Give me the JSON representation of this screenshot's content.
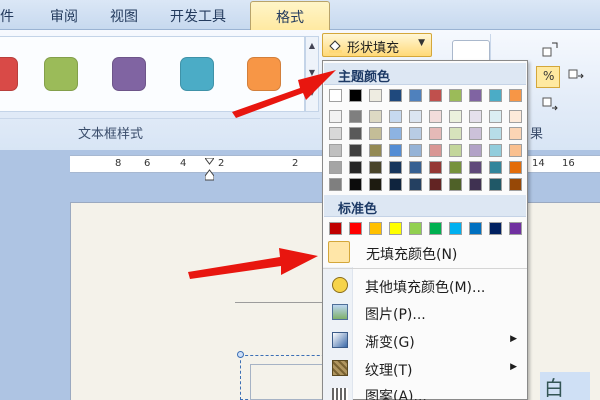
{
  "tabs": [
    {
      "label": "邮件"
    },
    {
      "label": "审阅"
    },
    {
      "label": "视图"
    },
    {
      "label": "开发工具"
    },
    {
      "label": "格式",
      "active": true
    }
  ],
  "gallery": {
    "swatch_colors": [
      "#d94a47",
      "#9bbb59",
      "#8064a2",
      "#4bacc6",
      "#f79646"
    ],
    "group_label": "文本框样式"
  },
  "fill_button": {
    "label": "形状填充"
  },
  "right_group_label": "果",
  "ruler_numbers": [
    "8",
    "6",
    "4",
    "2",
    "2",
    "14",
    "16"
  ],
  "menu": {
    "theme_header": "主题颜色",
    "theme_top_row": [
      "#ffffff",
      "#000000",
      "#eeece1",
      "#1f497d",
      "#4f81bd",
      "#c0504d",
      "#9bbb59",
      "#8064a2",
      "#4bacc6",
      "#f79646"
    ],
    "theme_shades": [
      [
        "#f2f2f2",
        "#7f7f7f",
        "#ddd9c3",
        "#c6d9f0",
        "#dbe5f1",
        "#f2dcdb",
        "#ebf1dd",
        "#e5e0ec",
        "#dbeef3",
        "#fdeada"
      ],
      [
        "#d8d8d8",
        "#595959",
        "#c4bd97",
        "#8db3e2",
        "#b8cce4",
        "#e5b9b7",
        "#d7e3bc",
        "#ccc1d9",
        "#b7dde8",
        "#fbd5b5"
      ],
      [
        "#bfbfbf",
        "#3f3f3f",
        "#938953",
        "#548dd4",
        "#95b3d7",
        "#d99694",
        "#c3d69b",
        "#b2a2c7",
        "#92cddc",
        "#fac08f"
      ],
      [
        "#a5a5a5",
        "#262626",
        "#494429",
        "#17365d",
        "#366092",
        "#953734",
        "#76923c",
        "#5f497a",
        "#31859b",
        "#e36c09"
      ],
      [
        "#7f7f7f",
        "#0c0c0c",
        "#1d1b10",
        "#0f243e",
        "#244061",
        "#632423",
        "#4f6128",
        "#3f3151",
        "#205867",
        "#974806"
      ]
    ],
    "standard_header": "标准色",
    "standard_colors": [
      "#c00000",
      "#ff0000",
      "#ffc000",
      "#ffff00",
      "#92d050",
      "#00b050",
      "#00b0f0",
      "#0070c0",
      "#002060",
      "#7030a0"
    ],
    "items": [
      {
        "label": "无填充颜色(N)",
        "icon": "no-fill-swatch-icon",
        "submenu": false
      },
      {
        "label": "其他填充颜色(M)...",
        "icon": "color-palette-icon",
        "submenu": false
      },
      {
        "label": "图片(P)...",
        "icon": "picture-icon",
        "submenu": false
      },
      {
        "label": "渐变(G)",
        "icon": "gradient-icon",
        "submenu": true
      },
      {
        "label": "纹理(T)",
        "icon": "texture-icon",
        "submenu": true
      },
      {
        "label": "图案(A)...",
        "icon": "pattern-icon",
        "submenu": false
      }
    ]
  },
  "doc_text_fragment": "白",
  "accent_colors": {
    "arrow": "#e8160f",
    "highlight": "#ffd978"
  }
}
